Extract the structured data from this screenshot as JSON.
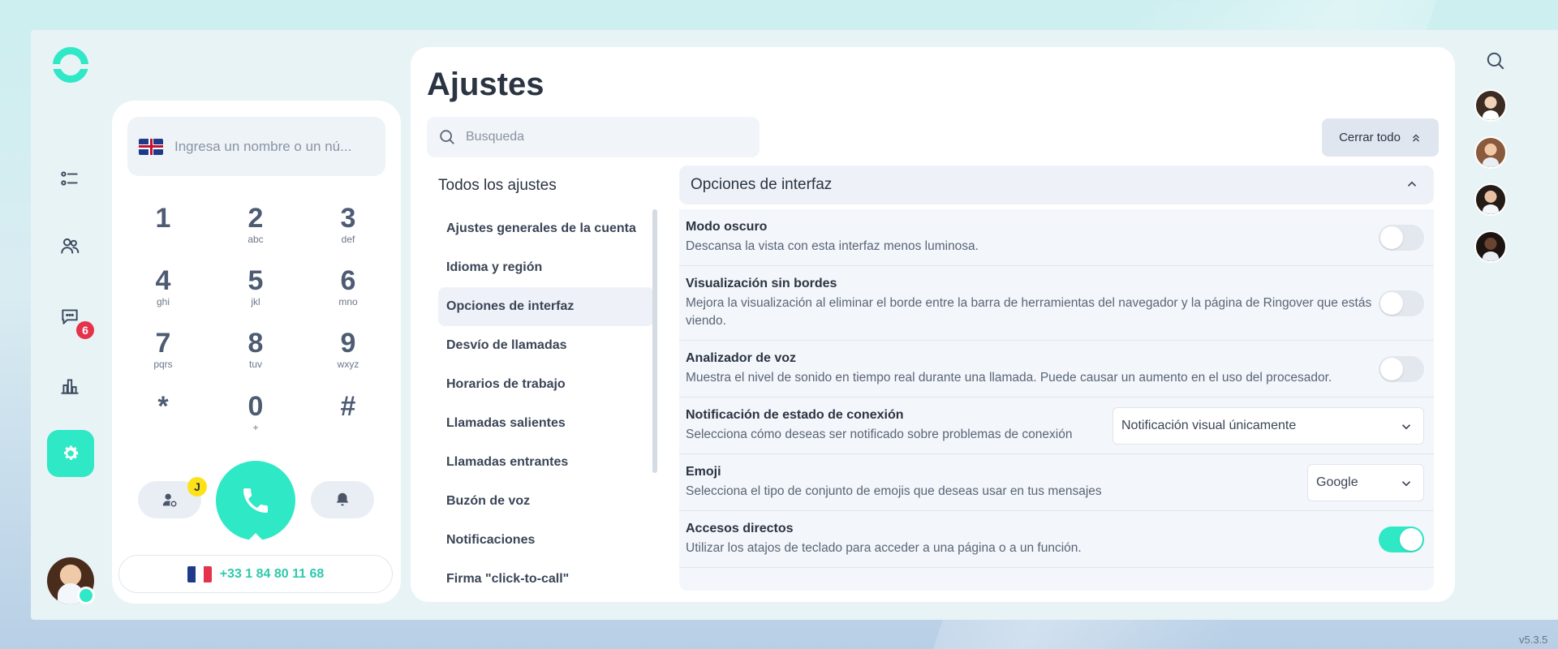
{
  "colors": {
    "accent": "#2ee8c6",
    "badge": "#e5334b",
    "yellow": "#ffe11a"
  },
  "rail": {
    "items": [
      {
        "icon": "tasks-icon"
      },
      {
        "icon": "contacts-icon"
      },
      {
        "icon": "chat-icon",
        "badge": "6"
      },
      {
        "icon": "stats-icon"
      },
      {
        "icon": "settings-icon",
        "active": true
      }
    ]
  },
  "dialer": {
    "input_placeholder": "Ingresa un nombre o un nú...",
    "keys": [
      {
        "num": "1",
        "sub": ""
      },
      {
        "num": "2",
        "sub": "abc"
      },
      {
        "num": "3",
        "sub": "def"
      },
      {
        "num": "4",
        "sub": "ghi"
      },
      {
        "num": "5",
        "sub": "jkl"
      },
      {
        "num": "6",
        "sub": "mno"
      },
      {
        "num": "7",
        "sub": "pqrs"
      },
      {
        "num": "8",
        "sub": "tuv"
      },
      {
        "num": "9",
        "sub": "wxyz"
      },
      {
        "num": "*",
        "sub": ""
      },
      {
        "num": "0",
        "sub": "+"
      },
      {
        "num": "#",
        "sub": ""
      }
    ],
    "j_badge": "J",
    "phone_number": "+33 1 84 80 11 68"
  },
  "main": {
    "title": "Ajustes",
    "search_placeholder": "Busqueda",
    "close_all_label": "Cerrar todo",
    "nav_title": "Todos los ajustes",
    "nav_items": [
      {
        "label": "Ajustes generales de la cuenta"
      },
      {
        "label": "Idioma y región"
      },
      {
        "label": "Opciones de interfaz",
        "active": true
      },
      {
        "label": "Desvío de llamadas"
      },
      {
        "label": "Horarios de trabajo"
      },
      {
        "label": "Llamadas salientes"
      },
      {
        "label": "Llamadas entrantes"
      },
      {
        "label": "Buzón de voz"
      },
      {
        "label": "Notificaciones"
      },
      {
        "label": "Firma \"click-to-call\""
      }
    ],
    "section_title": "Opciones de interfaz",
    "settings": [
      {
        "name": "Modo oscuro",
        "desc": "Descansa la vista con esta interfaz menos luminosa.",
        "control": "toggle",
        "value": false
      },
      {
        "name": "Visualización sin bordes",
        "desc": "Mejora la visualización al eliminar el borde entre la barra de herramientas del navegador y la página de Ringover que estás viendo.",
        "control": "toggle",
        "value": false
      },
      {
        "name": "Analizador de voz",
        "desc": "Muestra el nivel de sonido en tiempo real durante una llamada. Puede causar un aumento en el uso del procesador.",
        "control": "toggle",
        "value": false
      },
      {
        "name": "Notificación de estado de conexión",
        "desc": "Selecciona cómo deseas ser notificado sobre problemas de conexión",
        "control": "select",
        "value": "Notificación visual únicamente"
      },
      {
        "name": "Emoji",
        "desc": "Selecciona el tipo de conjunto de emojis que deseas usar en tus mensajes",
        "control": "select",
        "value": "Google"
      },
      {
        "name": "Accesos directos",
        "desc": "Utilizar los atajos de teclado para acceder a una página o a un función.",
        "control": "toggle",
        "value": true
      }
    ]
  },
  "right_rail": {
    "contacts": [
      {
        "icon": "contact-avatar-icon"
      },
      {
        "icon": "contact-avatar-icon"
      },
      {
        "icon": "contact-avatar-icon"
      },
      {
        "icon": "contact-avatar-icon"
      }
    ]
  },
  "version": "v5.3.5"
}
